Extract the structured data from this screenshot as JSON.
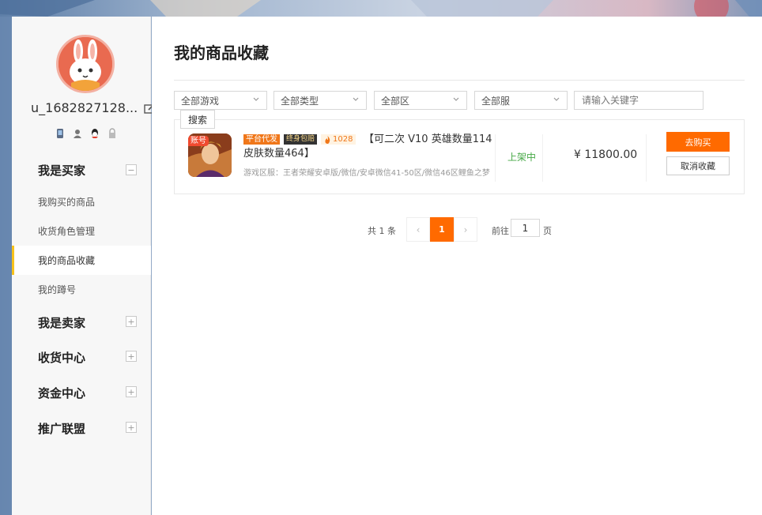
{
  "user": {
    "username": "u_1682827128...",
    "status_icons": [
      "phone-icon",
      "user-icon",
      "qq-icon",
      "lock-icon"
    ]
  },
  "sidebar": {
    "groups": [
      {
        "title": "我是买家",
        "toggle": "−",
        "items": [
          {
            "label": "我购买的商品"
          },
          {
            "label": "收货角色管理"
          },
          {
            "label": "我的商品收藏"
          },
          {
            "label": "我的蹲号"
          }
        ]
      },
      {
        "title": "我是卖家",
        "toggle": "+"
      },
      {
        "title": "收货中心",
        "toggle": "+"
      },
      {
        "title": "资金中心",
        "toggle": "+"
      },
      {
        "title": "推广联盟",
        "toggle": "+"
      }
    ]
  },
  "main": {
    "title": "我的商品收藏",
    "filters": {
      "game": "全部游戏",
      "type": "全部类型",
      "zone": "全部区",
      "server": "全部服",
      "keyword_placeholder": "请输入关键字",
      "search_label": "搜索"
    },
    "goods": {
      "thumb_badge": "账号",
      "tag_platform": "平台代发",
      "tag_insurance": "终身包赔",
      "hot_count": "1028",
      "title": "【可二次 V10 英雄数量114 皮肤数量464】",
      "server_line": "游戏区服：王者荣耀安卓版/微信/安卓微信41-50区/微信46区鲤鱼之梦",
      "status": "上架中",
      "price": "¥ 11800.00",
      "buy_label": "去购买",
      "cancel_label": "取消收藏"
    },
    "pagination": {
      "total": "共 1 条",
      "current_page": "1",
      "prev": "‹",
      "next": "›",
      "goto_label": "前往",
      "goto_value": "1",
      "page_unit": "页"
    }
  },
  "colors": {
    "accent": "#ff6a00",
    "active_marker": "#f7c21b",
    "status_green": "#46a846"
  }
}
